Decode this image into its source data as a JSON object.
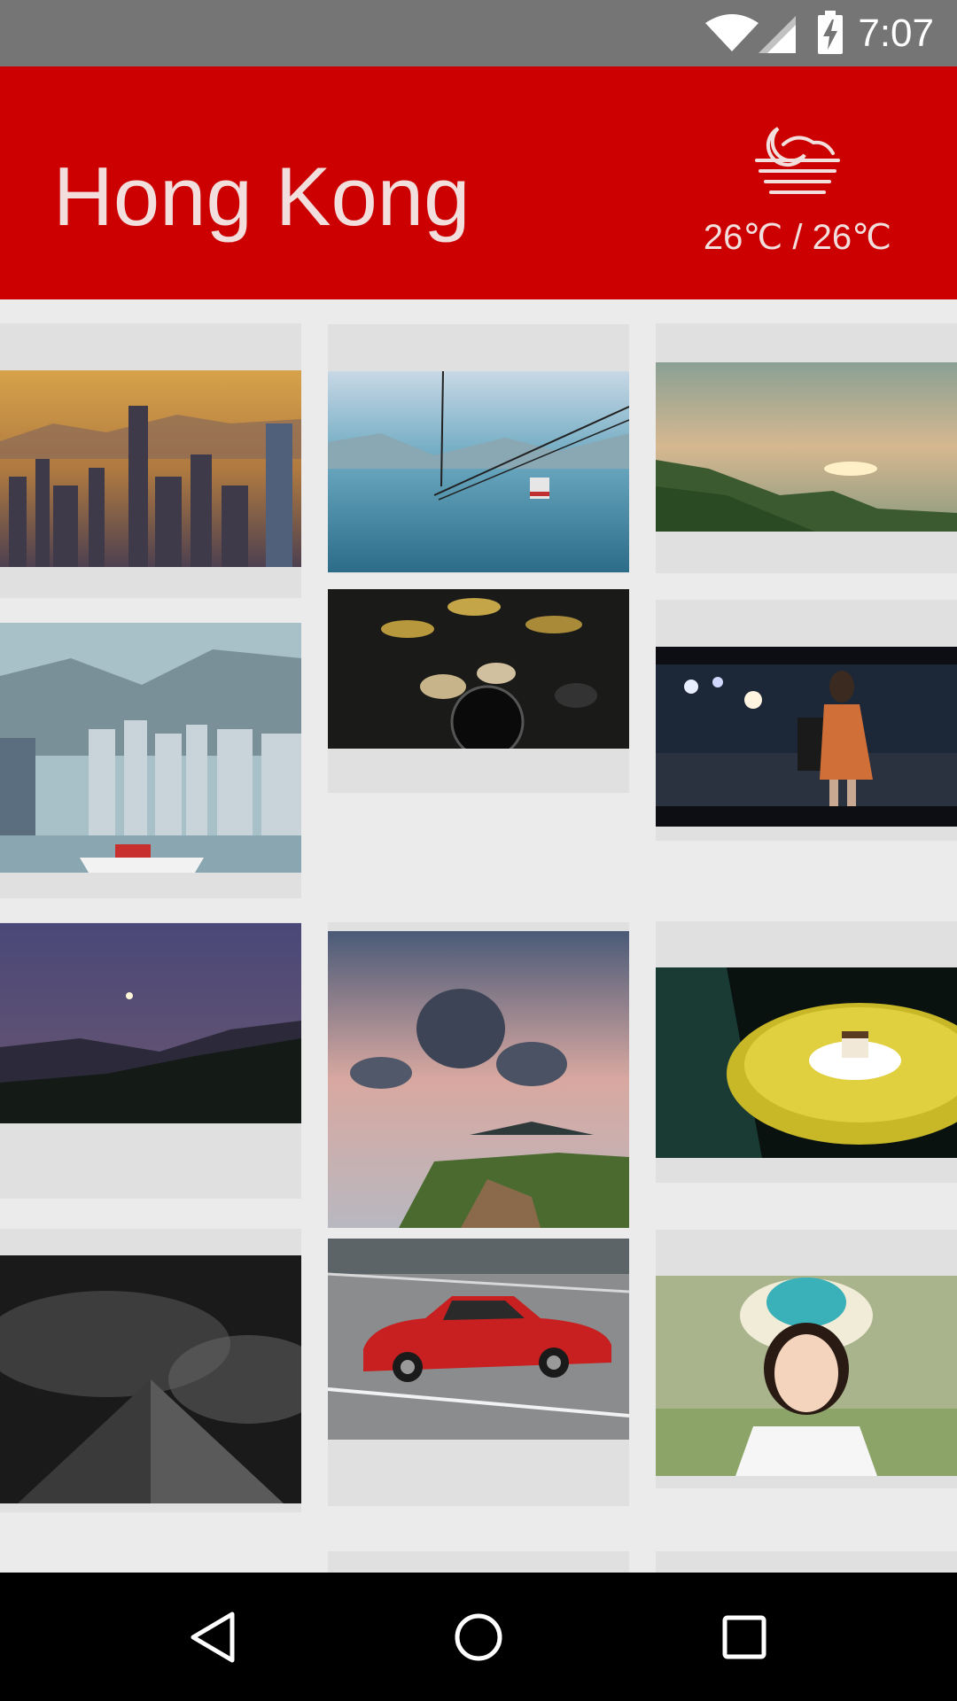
{
  "status_bar": {
    "time": "7:07",
    "icons": [
      "wifi-icon",
      "cell-signal-icon",
      "battery-charging-icon"
    ]
  },
  "header": {
    "city": "Hong Kong",
    "weather_icon": "moon-haze-icon",
    "temperature": "26℃ / 26℃",
    "background_color": "#cc0000"
  },
  "gallery": {
    "photos": [
      "hong-kong-skyline-sunset",
      "cable-car-over-bay",
      "mountain-sunset-sea",
      "hazy-city-harbor-ferry",
      "drum-kit",
      "woman-at-night-street",
      "moon-over-hills",
      "clouds-over-lighthouse-cliff",
      "dessert-on-table",
      "pyramid-building-dark-sky",
      "red-vintage-car",
      "girl-in-sun-hat"
    ]
  },
  "nav_bar": {
    "buttons": [
      "back-icon",
      "home-icon",
      "recents-icon"
    ]
  }
}
